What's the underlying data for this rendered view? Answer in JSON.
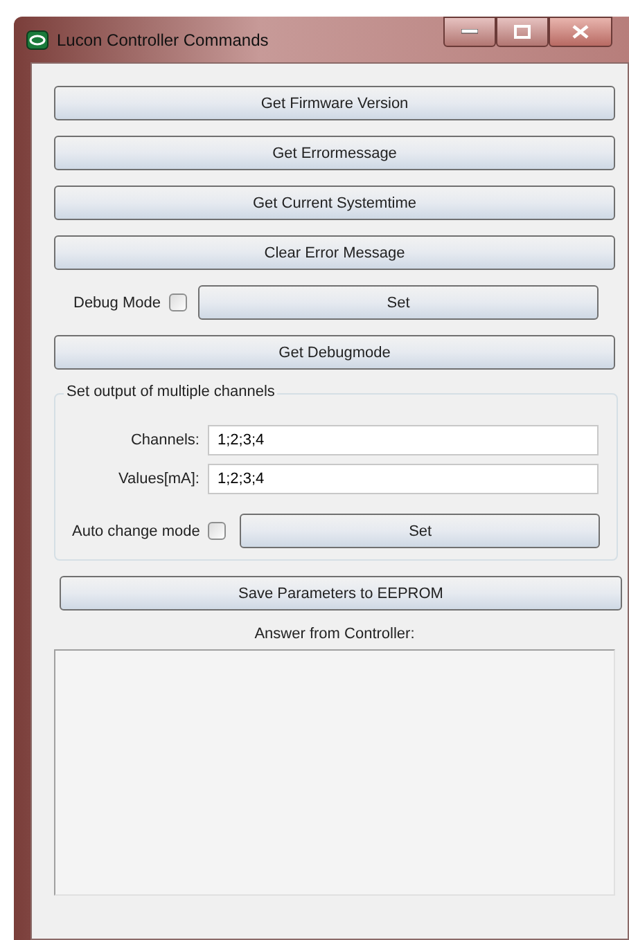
{
  "window": {
    "title": "Lucon Controller Commands"
  },
  "commands": [
    {
      "label": "Get Firmware Version"
    },
    {
      "label": "Get Errormessage"
    },
    {
      "label": "Get Current Systemtime"
    },
    {
      "label": "Clear Error Message"
    }
  ],
  "debug": {
    "label": "Debug Mode",
    "checked": false,
    "button": "Set"
  },
  "get_debugmode": {
    "label": "Get Debugmode"
  },
  "group": {
    "title": "Set output of multiple channels",
    "fields": [
      {
        "label": "Channels:",
        "value": "1;2;3;4"
      },
      {
        "label": "Values[mA]:",
        "value": "1;2;3;4"
      }
    ],
    "auto_change": {
      "label": "Auto change mode",
      "checked": false,
      "button": "Set"
    }
  },
  "save": {
    "label": "Save Parameters to EEPROM"
  },
  "answer": {
    "label": "Answer from Controller:"
  }
}
